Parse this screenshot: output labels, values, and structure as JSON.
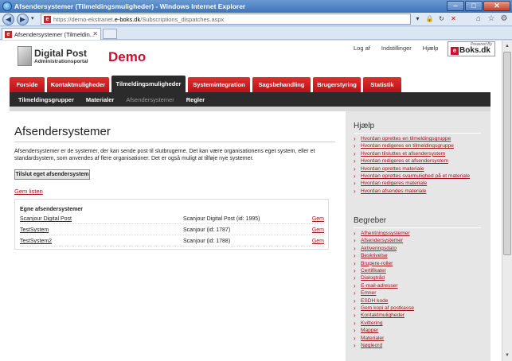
{
  "window": {
    "title": "Afsendersystemer (Tilmeldingsmuligheder) - Windows Internet Explorer",
    "min": "‒",
    "max": "□",
    "close": "✕"
  },
  "addressbar": {
    "back": "◀",
    "forward": "▶",
    "url_scheme": "https://demo-ekstranet.",
    "url_host": "e-boks.dk",
    "url_path": "/Subscriptions_dispatches.aspx",
    "favicon": "e"
  },
  "browser_tab": {
    "label": "Afsendersystemer (Tilmeldin...",
    "close": "✕"
  },
  "header": {
    "logo_title": "Digital Post",
    "logo_subtitle": "Administrationsportal",
    "demo_label": "Demo",
    "links": [
      "Log af",
      "Indstillinger",
      "Hjælp"
    ],
    "eboks_powered": "Powered By",
    "eboks_text": "Boks.dk",
    "eboks_e": "e"
  },
  "mainnav": [
    {
      "label": "Forside"
    },
    {
      "label": "Kontaktmuligheder"
    },
    {
      "label": "Tilmeldingsmuligheder"
    },
    {
      "label": "Systemintegration"
    },
    {
      "label": "Sagsbehandling"
    },
    {
      "label": "Brugerstyring"
    },
    {
      "label": "Statistik"
    }
  ],
  "subnav": [
    {
      "label": "Tilmeldingsgrupper"
    },
    {
      "label": "Materialer"
    },
    {
      "label": "Afsendersystemer"
    },
    {
      "label": "Regler"
    }
  ],
  "content": {
    "heading": "Afsendersystemer",
    "description": "Afsendersystemer er de systemer, der kan sende post til slutbrugerne. Det kan være organisationens eget system, eller et standardsystem, som anvendes af flere organisationer. Det er også muligt at tilføje nye systemer.",
    "connect_button": "Tilslut eget afsendersystem",
    "hide_list": "Gem listen",
    "list_title": "Egne afsendersystemer",
    "rows": [
      {
        "name": "Scanjour Digital Post",
        "system": "Scanjour Digital Post (id: 1995)",
        "action": "Gem"
      },
      {
        "name": "TestSystem",
        "system": "Scanjour (id: 1787)",
        "action": "Gem"
      },
      {
        "name": "TestSystem2",
        "system": "Scanjour (id: 1788)",
        "action": "Gem"
      }
    ]
  },
  "sidebar": {
    "help_title": "Hjælp",
    "help_links": [
      "Hvordan oprettes en tilmeldingsgruppe",
      "Hvordan redigeres en tilmeldingsgruppe",
      "Hvordan tilsluttes et afsendersystem",
      "Hvordan redigeres et afsendersystem",
      "Hvordan oprettes materiale",
      "Hvordan oprettes svarmulighed på et materiale",
      "Hvordan redigeres materiale",
      "Hvordan afsendes materiale"
    ],
    "terms_title": "Begreber",
    "terms": [
      "Afhentningssystemer",
      "Afsendersystemer",
      "Aktiveringsdato",
      "Beskrivelse",
      "Brugere-roller",
      "Certifikater",
      "Dialogtråd",
      "E-mail-adresser",
      "Emner",
      "ESDH kode",
      "Gem kopi af postkasse",
      "Kontaktmuligheder",
      "Kvittering",
      "Mapper",
      "Materialer",
      "Nøgleord"
    ]
  },
  "colors": {
    "brand_red": "#c8102e",
    "link_red": "#a3121d",
    "nav_dark": "#2b2b2b",
    "sidebar_bg": "#e6e6e6"
  }
}
